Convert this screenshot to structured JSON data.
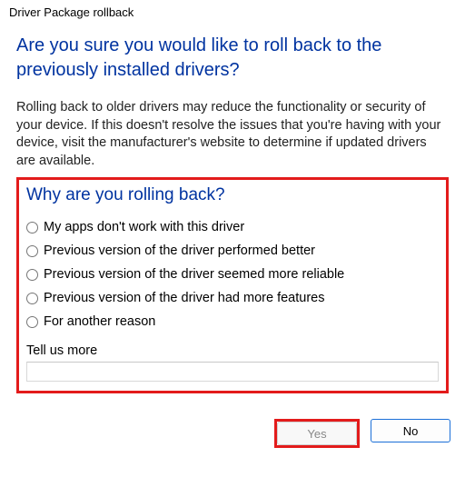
{
  "title": "Driver Package rollback",
  "heading": "Are you sure you would like to roll back to the previously installed drivers?",
  "description": "Rolling back to older drivers may reduce the functionality or security of your device. If this doesn't resolve the issues that you're having with your device, visit the manufacturer's website to determine if updated drivers are available.",
  "reason": {
    "heading": "Why are you rolling back?",
    "options": [
      "My apps don't work with this driver",
      "Previous version of the driver performed better",
      "Previous version of the driver seemed more reliable",
      "Previous version of the driver had more features",
      "For another reason"
    ],
    "tell_us_label": "Tell us more",
    "tell_us_value": ""
  },
  "buttons": {
    "yes": "Yes",
    "no": "No"
  }
}
